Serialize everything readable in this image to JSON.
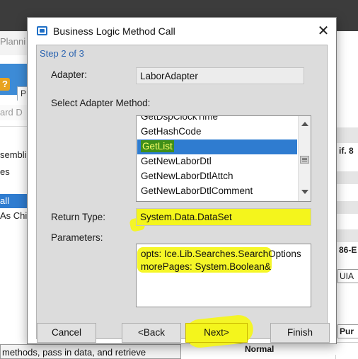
{
  "background": {
    "planning_text": "Planni",
    "help_icon_label": "?",
    "tab_label": "P",
    "ward_text": "ard D",
    "left_rows": [
      "sembli",
      "es",
      "all",
      "As Chil"
    ],
    "tooltip_text": "methods, pass in data, and retrieve",
    "right_texts": [
      "if. 8",
      "86-E",
      "UIA",
      "Pur"
    ],
    "normal_label": "Normal"
  },
  "dialog": {
    "title": "Business Logic Method Call",
    "step": "Step 2 of 3",
    "adapter_label": "Adapter:",
    "adapter_value": "LaborAdapter",
    "select_method_label": "Select Adapter Method:",
    "methods": [
      "GetDspClockTime",
      "GetHashCode",
      "GetList",
      "GetNewLaborDtl",
      "GetNewLaborDtlAttch",
      "GetNewLaborDtlComment"
    ],
    "selected_method": "GetList",
    "return_type_label": "Return Type:",
    "return_type_value": "System.Data.DataSet",
    "parameters_label": "Parameters:",
    "parameters": [
      "opts: Ice.Lib.Searches.SearchOptions",
      "morePages: System.Boolean&"
    ],
    "buttons": {
      "cancel": "Cancel",
      "back": "<Back",
      "next": "Next>",
      "finish": "Finish"
    }
  },
  "colors": {
    "selection_blue": "#2f7cd0",
    "highlighter_yellow": "#f4f51c",
    "highlighter_green": "#3f8f18",
    "step_text_blue": "#2a63b0"
  }
}
